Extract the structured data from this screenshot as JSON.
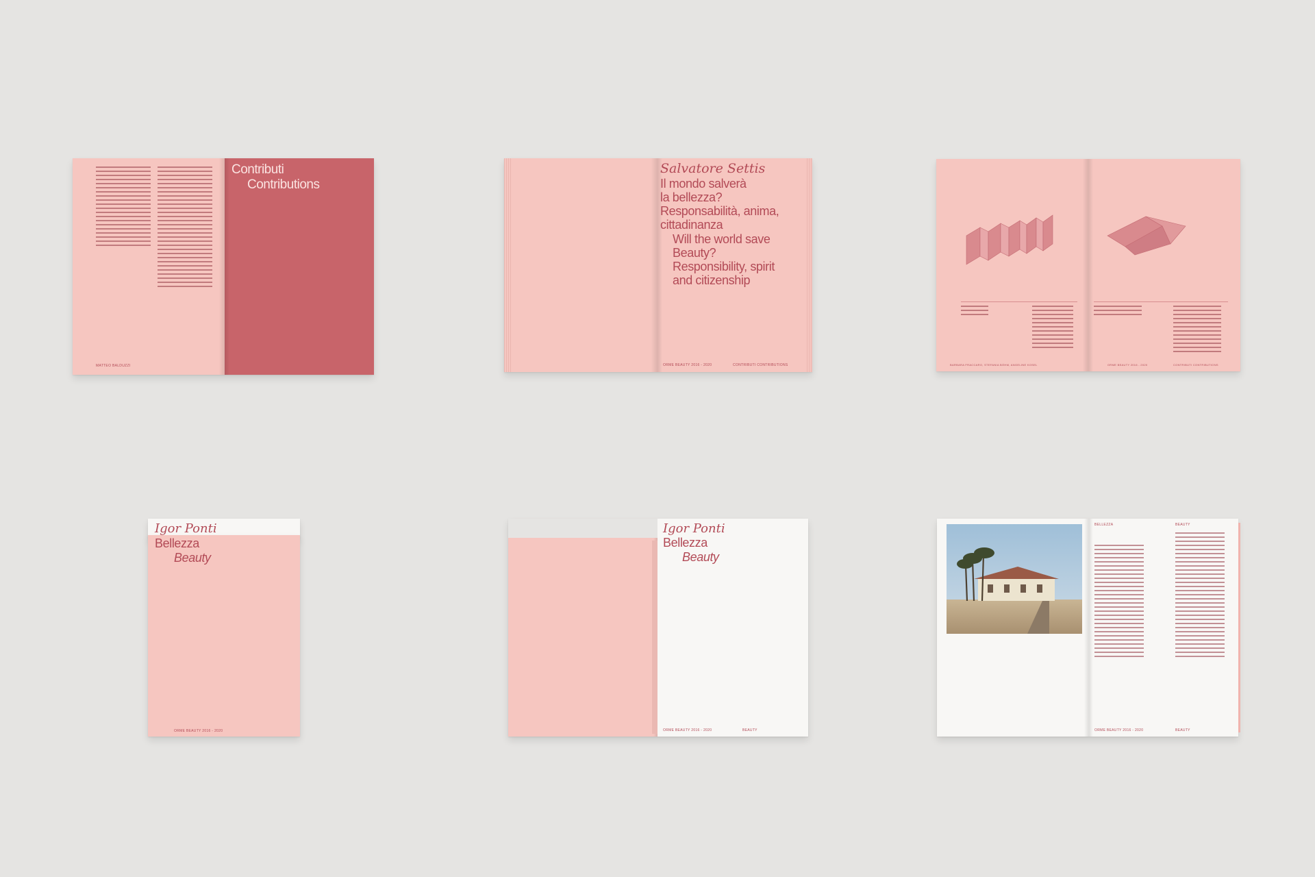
{
  "spread1": {
    "heading_line1": "Contributi",
    "heading_line2": "Contributions",
    "footer_left": "MATTEO BALDUZZI"
  },
  "spread2": {
    "author": "Salvatore Settis",
    "title_it_lines": [
      "Il mondo salverà",
      "la bellezza?",
      "Responsabilità, anima,",
      "cittadinanza"
    ],
    "title_en_lines": [
      "Will the world save",
      "Beauty?",
      "Responsibility, spirit",
      "and citizenship"
    ],
    "footer_left": "ORME BEAUTY 2016 - 2020",
    "footer_right": "CONTRIBUTI CONTRIBUTIONS"
  },
  "spread3": {
    "footer_left": "BARBARA FRACCARO, STEFANIA BÖHM, ANGELINE KOSEL",
    "footer_center": "ORME BEAUTY 2016 - 2020",
    "footer_right": "CONTRIBUTI CONTRIBUTIONS"
  },
  "book4": {
    "author": "Igor Ponti",
    "title_it": "Bellezza",
    "title_en": "Beauty",
    "footer": "ORME BEAUTY 2016 - 2020"
  },
  "book5": {
    "author": "Igor Ponti",
    "title_it": "Bellezza",
    "title_en": "Beauty",
    "footer_left": "ORME BEAUTY 2016 - 2020",
    "footer_right": "BEAUTY"
  },
  "spread6": {
    "header_left": "BELLEZZA",
    "header_right": "BEAUTY",
    "footer_left": "ORME BEAUTY 2016 - 2020",
    "footer_right": "BEAUTY"
  },
  "colors": {
    "background": "#e5e4e2",
    "pink_paper": "#f6c6c0",
    "rose_page": "#c8646a",
    "ink": "#b24a56",
    "white_paper": "#f8f7f5"
  }
}
